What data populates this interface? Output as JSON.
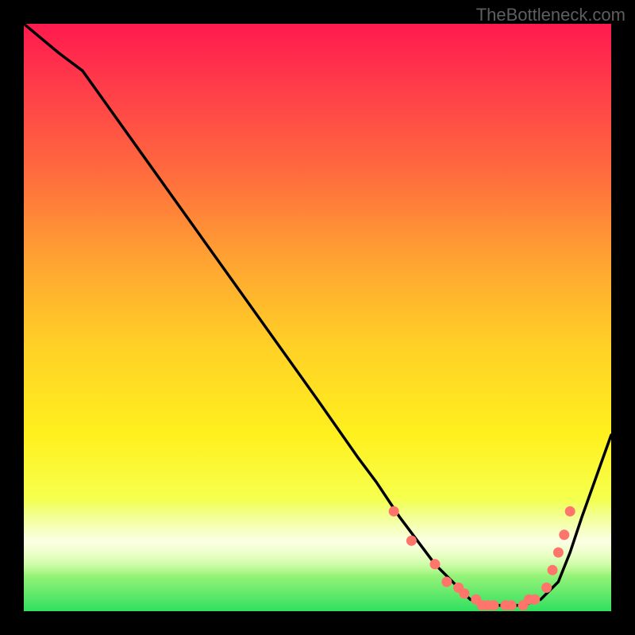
{
  "watermark": "TheBottleneck.com",
  "chart_data": {
    "type": "line",
    "title": "",
    "xlabel": "",
    "ylabel": "",
    "xlim": [
      0,
      100
    ],
    "ylim": [
      0,
      100
    ],
    "series": [
      {
        "name": "curve",
        "x": [
          0,
          6,
          10,
          20,
          30,
          40,
          50,
          57,
          60,
          64,
          67,
          70,
          73,
          76,
          79,
          82,
          85,
          88,
          91,
          93,
          95,
          100
        ],
        "y": [
          100,
          95,
          92,
          78,
          64,
          50,
          36,
          26,
          22,
          16,
          12,
          8,
          5,
          2,
          1,
          1,
          1,
          2,
          5,
          10,
          16,
          30
        ]
      }
    ],
    "markers": {
      "name": "bottom-points",
      "x": [
        63,
        66,
        70,
        72,
        74,
        75,
        77,
        78,
        79,
        80,
        82,
        83,
        85,
        86,
        87,
        89,
        90,
        91,
        92,
        93
      ],
      "y": [
        17,
        12,
        8,
        5,
        4,
        3,
        2,
        1,
        1,
        1,
        1,
        1,
        1,
        2,
        2,
        4,
        7,
        10,
        13,
        17
      ]
    },
    "background": {
      "type": "vertical-gradient",
      "stops": [
        {
          "pos": 0,
          "color": "#ff1a4e"
        },
        {
          "pos": 0.4,
          "color": "#ffa232"
        },
        {
          "pos": 0.7,
          "color": "#fff01e"
        },
        {
          "pos": 1,
          "color": "#30e060"
        }
      ]
    }
  }
}
